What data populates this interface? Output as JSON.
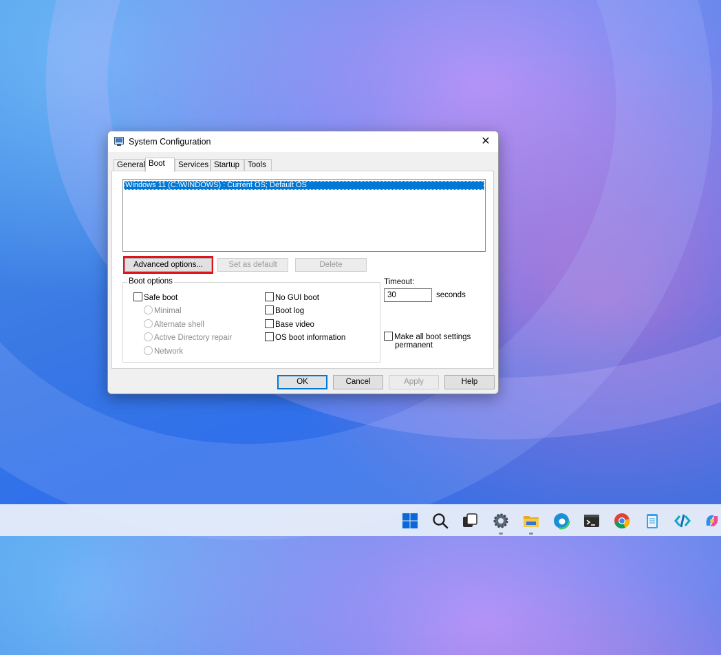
{
  "window": {
    "title": "System Configuration",
    "close_glyph": "✕"
  },
  "tabs": [
    {
      "label": "General"
    },
    {
      "label": "Boot",
      "active": true
    },
    {
      "label": "Services"
    },
    {
      "label": "Startup"
    },
    {
      "label": "Tools"
    }
  ],
  "boot_list": {
    "items": [
      "Windows 11 (C:\\WINDOWS) : Current OS; Default OS"
    ]
  },
  "actions": {
    "advanced_options": "Advanced options...",
    "set_as_default": "Set as default",
    "delete": "Delete"
  },
  "boot_options": {
    "title": "Boot options",
    "safe_boot": "Safe boot",
    "minimal": "Minimal",
    "alternate_shell": "Alternate shell",
    "active_directory_repair": "Active Directory repair",
    "network": "Network",
    "no_gui_boot": "No GUI boot",
    "boot_log": "Boot log",
    "base_video": "Base video",
    "os_boot_information": "OS boot information"
  },
  "timeout": {
    "label": "Timeout:",
    "value": "30",
    "unit": "seconds"
  },
  "make_permanent": {
    "line1": "Make all boot settings",
    "line2": "permanent"
  },
  "footer": {
    "ok": "OK",
    "cancel": "Cancel",
    "apply": "Apply",
    "help": "Help"
  },
  "taskbar": {
    "icons": [
      "start-icon",
      "search-icon",
      "task-view-icon",
      "settings-icon",
      "file-explorer-icon",
      "edge-icon",
      "terminal-icon",
      "chrome-icon",
      "notepad-icon",
      "dev-tool-icon",
      "copilot-icon"
    ]
  },
  "colors": {
    "selection": "#0078d7",
    "highlight_box": "#e0121c"
  }
}
